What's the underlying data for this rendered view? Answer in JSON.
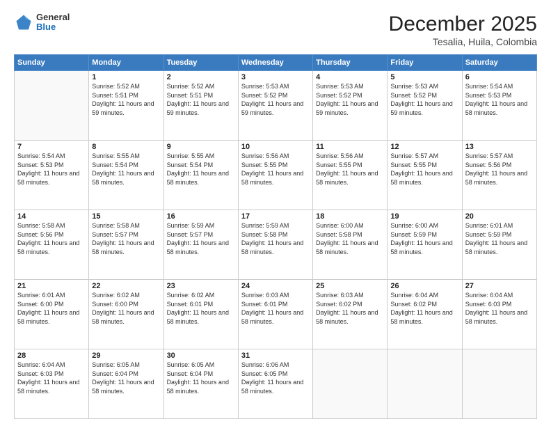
{
  "logo": {
    "general": "General",
    "blue": "Blue"
  },
  "title": "December 2025",
  "subtitle": "Tesalia, Huila, Colombia",
  "weekdays": [
    "Sunday",
    "Monday",
    "Tuesday",
    "Wednesday",
    "Thursday",
    "Friday",
    "Saturday"
  ],
  "weeks": [
    [
      {
        "day": "",
        "sunrise": "",
        "sunset": "",
        "daylight": ""
      },
      {
        "day": "1",
        "sunrise": "Sunrise: 5:52 AM",
        "sunset": "Sunset: 5:51 PM",
        "daylight": "Daylight: 11 hours and 59 minutes."
      },
      {
        "day": "2",
        "sunrise": "Sunrise: 5:52 AM",
        "sunset": "Sunset: 5:51 PM",
        "daylight": "Daylight: 11 hours and 59 minutes."
      },
      {
        "day": "3",
        "sunrise": "Sunrise: 5:53 AM",
        "sunset": "Sunset: 5:52 PM",
        "daylight": "Daylight: 11 hours and 59 minutes."
      },
      {
        "day": "4",
        "sunrise": "Sunrise: 5:53 AM",
        "sunset": "Sunset: 5:52 PM",
        "daylight": "Daylight: 11 hours and 59 minutes."
      },
      {
        "day": "5",
        "sunrise": "Sunrise: 5:53 AM",
        "sunset": "Sunset: 5:52 PM",
        "daylight": "Daylight: 11 hours and 59 minutes."
      },
      {
        "day": "6",
        "sunrise": "Sunrise: 5:54 AM",
        "sunset": "Sunset: 5:53 PM",
        "daylight": "Daylight: 11 hours and 58 minutes."
      }
    ],
    [
      {
        "day": "7",
        "sunrise": "Sunrise: 5:54 AM",
        "sunset": "Sunset: 5:53 PM",
        "daylight": "Daylight: 11 hours and 58 minutes."
      },
      {
        "day": "8",
        "sunrise": "Sunrise: 5:55 AM",
        "sunset": "Sunset: 5:54 PM",
        "daylight": "Daylight: 11 hours and 58 minutes."
      },
      {
        "day": "9",
        "sunrise": "Sunrise: 5:55 AM",
        "sunset": "Sunset: 5:54 PM",
        "daylight": "Daylight: 11 hours and 58 minutes."
      },
      {
        "day": "10",
        "sunrise": "Sunrise: 5:56 AM",
        "sunset": "Sunset: 5:55 PM",
        "daylight": "Daylight: 11 hours and 58 minutes."
      },
      {
        "day": "11",
        "sunrise": "Sunrise: 5:56 AM",
        "sunset": "Sunset: 5:55 PM",
        "daylight": "Daylight: 11 hours and 58 minutes."
      },
      {
        "day": "12",
        "sunrise": "Sunrise: 5:57 AM",
        "sunset": "Sunset: 5:55 PM",
        "daylight": "Daylight: 11 hours and 58 minutes."
      },
      {
        "day": "13",
        "sunrise": "Sunrise: 5:57 AM",
        "sunset": "Sunset: 5:56 PM",
        "daylight": "Daylight: 11 hours and 58 minutes."
      }
    ],
    [
      {
        "day": "14",
        "sunrise": "Sunrise: 5:58 AM",
        "sunset": "Sunset: 5:56 PM",
        "daylight": "Daylight: 11 hours and 58 minutes."
      },
      {
        "day": "15",
        "sunrise": "Sunrise: 5:58 AM",
        "sunset": "Sunset: 5:57 PM",
        "daylight": "Daylight: 11 hours and 58 minutes."
      },
      {
        "day": "16",
        "sunrise": "Sunrise: 5:59 AM",
        "sunset": "Sunset: 5:57 PM",
        "daylight": "Daylight: 11 hours and 58 minutes."
      },
      {
        "day": "17",
        "sunrise": "Sunrise: 5:59 AM",
        "sunset": "Sunset: 5:58 PM",
        "daylight": "Daylight: 11 hours and 58 minutes."
      },
      {
        "day": "18",
        "sunrise": "Sunrise: 6:00 AM",
        "sunset": "Sunset: 5:58 PM",
        "daylight": "Daylight: 11 hours and 58 minutes."
      },
      {
        "day": "19",
        "sunrise": "Sunrise: 6:00 AM",
        "sunset": "Sunset: 5:59 PM",
        "daylight": "Daylight: 11 hours and 58 minutes."
      },
      {
        "day": "20",
        "sunrise": "Sunrise: 6:01 AM",
        "sunset": "Sunset: 5:59 PM",
        "daylight": "Daylight: 11 hours and 58 minutes."
      }
    ],
    [
      {
        "day": "21",
        "sunrise": "Sunrise: 6:01 AM",
        "sunset": "Sunset: 6:00 PM",
        "daylight": "Daylight: 11 hours and 58 minutes."
      },
      {
        "day": "22",
        "sunrise": "Sunrise: 6:02 AM",
        "sunset": "Sunset: 6:00 PM",
        "daylight": "Daylight: 11 hours and 58 minutes."
      },
      {
        "day": "23",
        "sunrise": "Sunrise: 6:02 AM",
        "sunset": "Sunset: 6:01 PM",
        "daylight": "Daylight: 11 hours and 58 minutes."
      },
      {
        "day": "24",
        "sunrise": "Sunrise: 6:03 AM",
        "sunset": "Sunset: 6:01 PM",
        "daylight": "Daylight: 11 hours and 58 minutes."
      },
      {
        "day": "25",
        "sunrise": "Sunrise: 6:03 AM",
        "sunset": "Sunset: 6:02 PM",
        "daylight": "Daylight: 11 hours and 58 minutes."
      },
      {
        "day": "26",
        "sunrise": "Sunrise: 6:04 AM",
        "sunset": "Sunset: 6:02 PM",
        "daylight": "Daylight: 11 hours and 58 minutes."
      },
      {
        "day": "27",
        "sunrise": "Sunrise: 6:04 AM",
        "sunset": "Sunset: 6:03 PM",
        "daylight": "Daylight: 11 hours and 58 minutes."
      }
    ],
    [
      {
        "day": "28",
        "sunrise": "Sunrise: 6:04 AM",
        "sunset": "Sunset: 6:03 PM",
        "daylight": "Daylight: 11 hours and 58 minutes."
      },
      {
        "day": "29",
        "sunrise": "Sunrise: 6:05 AM",
        "sunset": "Sunset: 6:04 PM",
        "daylight": "Daylight: 11 hours and 58 minutes."
      },
      {
        "day": "30",
        "sunrise": "Sunrise: 6:05 AM",
        "sunset": "Sunset: 6:04 PM",
        "daylight": "Daylight: 11 hours and 58 minutes."
      },
      {
        "day": "31",
        "sunrise": "Sunrise: 6:06 AM",
        "sunset": "Sunset: 6:05 PM",
        "daylight": "Daylight: 11 hours and 58 minutes."
      },
      {
        "day": "",
        "sunrise": "",
        "sunset": "",
        "daylight": ""
      },
      {
        "day": "",
        "sunrise": "",
        "sunset": "",
        "daylight": ""
      },
      {
        "day": "",
        "sunrise": "",
        "sunset": "",
        "daylight": ""
      }
    ]
  ]
}
